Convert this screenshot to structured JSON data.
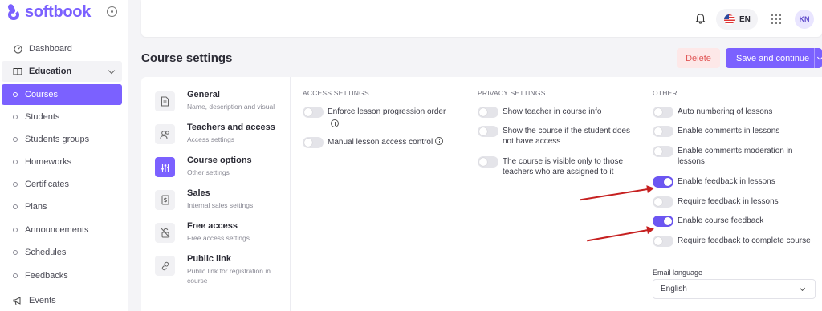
{
  "app": {
    "logo_text": "softbook"
  },
  "sidebar": {
    "items": [
      {
        "label": "Dashboard"
      },
      {
        "label": "Education"
      },
      {
        "label": "Courses"
      },
      {
        "label": "Students"
      },
      {
        "label": "Students groups"
      },
      {
        "label": "Homeworks"
      },
      {
        "label": "Certificates"
      },
      {
        "label": "Plans"
      },
      {
        "label": "Announcements"
      },
      {
        "label": "Schedules"
      },
      {
        "label": "Feedbacks"
      },
      {
        "label": "Events"
      }
    ]
  },
  "topbar": {
    "language": "EN",
    "avatar_initials": "KN"
  },
  "header": {
    "title": "Course settings",
    "delete_label": "Delete",
    "save_label": "Save and continue"
  },
  "settings_menu": [
    {
      "title": "General",
      "subtitle": "Name, description and visual"
    },
    {
      "title": "Teachers and access",
      "subtitle": "Access settings"
    },
    {
      "title": "Course options",
      "subtitle": "Other settings"
    },
    {
      "title": "Sales",
      "subtitle": "Internal sales settings"
    },
    {
      "title": "Free access",
      "subtitle": "Free access settings"
    },
    {
      "title": "Public link",
      "subtitle": "Public link for registration in course"
    }
  ],
  "access_settings": {
    "heading": "ACCESS SETTINGS",
    "options": [
      {
        "label": "Enforce lesson progression order",
        "enabled": false
      },
      {
        "label": "Manual lesson access control",
        "enabled": false
      }
    ]
  },
  "privacy_settings": {
    "heading": "PRIVACY SETTINGS",
    "options": [
      {
        "label": "Show teacher in course info",
        "enabled": false
      },
      {
        "label": "Show the course if the student does not have access",
        "enabled": false
      },
      {
        "label": "The course is visible only to those teachers who are assigned to it",
        "enabled": false
      }
    ]
  },
  "other_settings": {
    "heading": "OTHER",
    "options": [
      {
        "label": "Auto numbering of lessons",
        "enabled": false
      },
      {
        "label": "Enable comments in lessons",
        "enabled": false
      },
      {
        "label": "Enable comments moderation in lessons",
        "enabled": false
      },
      {
        "label": "Enable feedback in lessons",
        "enabled": true
      },
      {
        "label": "Require feedback in lessons",
        "enabled": false
      },
      {
        "label": "Enable course feedback",
        "enabled": true
      },
      {
        "label": "Require feedback to complete course",
        "enabled": false
      }
    ],
    "email_language_label": "Email language",
    "email_language_value": "English"
  },
  "colors": {
    "accent": "#7b61ff",
    "danger": "#e05555",
    "annotation_arrow": "#c62020"
  }
}
